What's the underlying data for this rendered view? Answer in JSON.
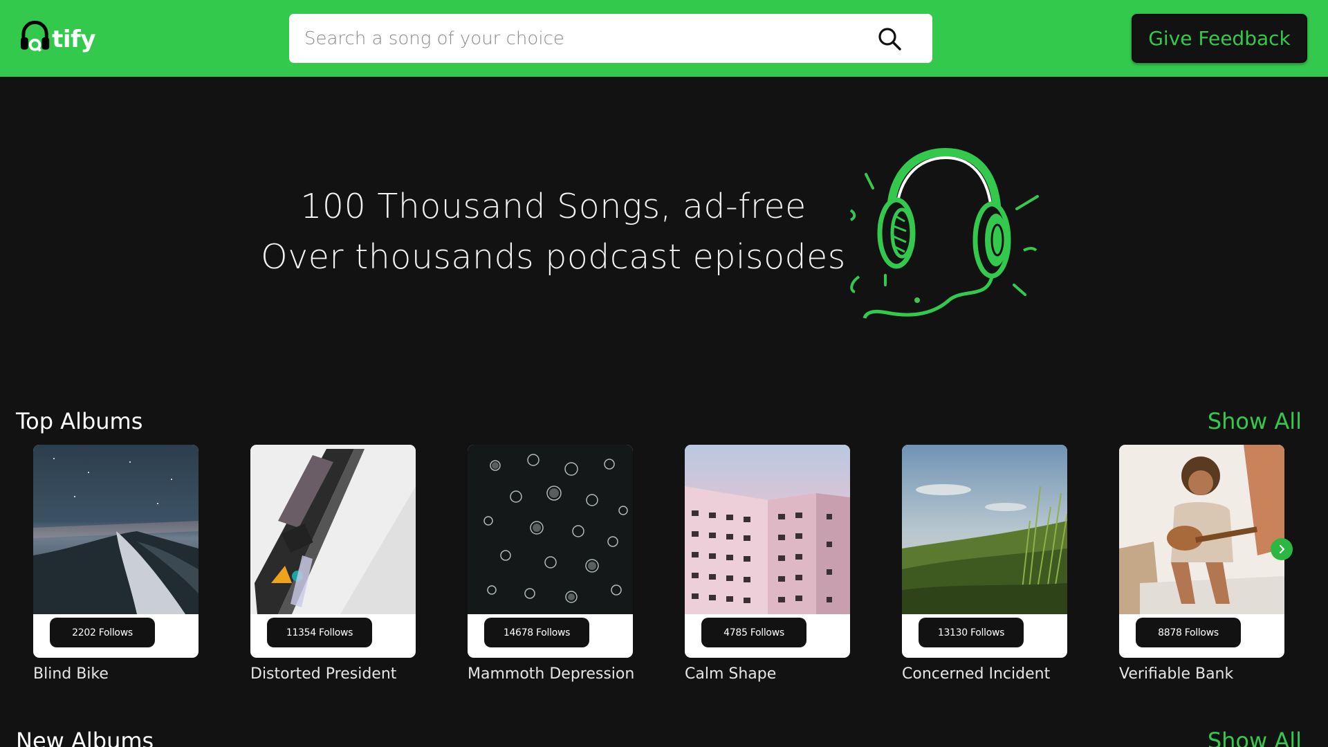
{
  "brand": {
    "logo_text": "tify",
    "accent_color": "#33c94d",
    "header_bg": "#33c94d",
    "page_bg": "#121212"
  },
  "header": {
    "search_placeholder": "Search a song of your choice",
    "search_icon": "search-icon",
    "feedback_label": "Give Feedback"
  },
  "hero": {
    "line1": "100 Thousand Songs, ad-free",
    "line2": "Over thousands podcast episodes",
    "illustration": "headphones-illustration"
  },
  "top_albums": {
    "title": "Top Albums",
    "show_all": "Show All",
    "items": [
      {
        "name": "Blind Bike",
        "follows": "2202 Follows"
      },
      {
        "name": "Distorted President",
        "follows": "11354 Follows"
      },
      {
        "name": "Mammoth Depression",
        "follows": "14678 Follows"
      },
      {
        "name": "Calm Shape",
        "follows": "4785 Follows"
      },
      {
        "name": "Concerned Incident",
        "follows": "13130 Follows"
      },
      {
        "name": "Verifiable Bank",
        "follows": "8878 Follows"
      }
    ]
  },
  "new_albums": {
    "title": "New Albums",
    "show_all": "Show All"
  }
}
